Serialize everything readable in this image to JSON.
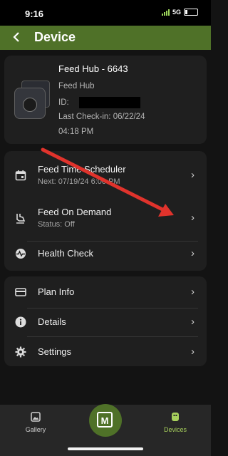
{
  "status_bar": {
    "time": "9:16",
    "network": "5G"
  },
  "header": {
    "title": "Device",
    "back_icon": "chevron-left-icon"
  },
  "device": {
    "name": "Feed Hub - 6643",
    "type": "Feed Hub",
    "id_label": "ID:",
    "last_checkin": "Last Check-in: 06/22/24",
    "last_checkin_time": "04:18 PM"
  },
  "menu_group1": [
    {
      "icon": "calendar-icon",
      "label": "Feed Time Scheduler",
      "sub": "Next: 07/19/24 6:00 PM"
    },
    {
      "icon": "touch-icon",
      "label": "Feed On Demand",
      "sub": "Status: Off"
    },
    {
      "icon": "heartbeat-icon",
      "label": "Health Check"
    }
  ],
  "menu_group2": [
    {
      "icon": "credit-card-icon",
      "label": "Plan Info"
    },
    {
      "icon": "info-icon",
      "label": "Details"
    },
    {
      "icon": "gear-icon",
      "label": "Settings"
    }
  ],
  "tabbar": {
    "left": {
      "label": "Gallery",
      "icon": "image-icon"
    },
    "center": {
      "label": "M",
      "icon": "logo-m-icon"
    },
    "right": {
      "label": "Devices",
      "icon": "device-icon"
    }
  },
  "colors": {
    "accent": "#4f7128",
    "active_tab": "#a8d15d",
    "arrow": "#e0332c"
  }
}
